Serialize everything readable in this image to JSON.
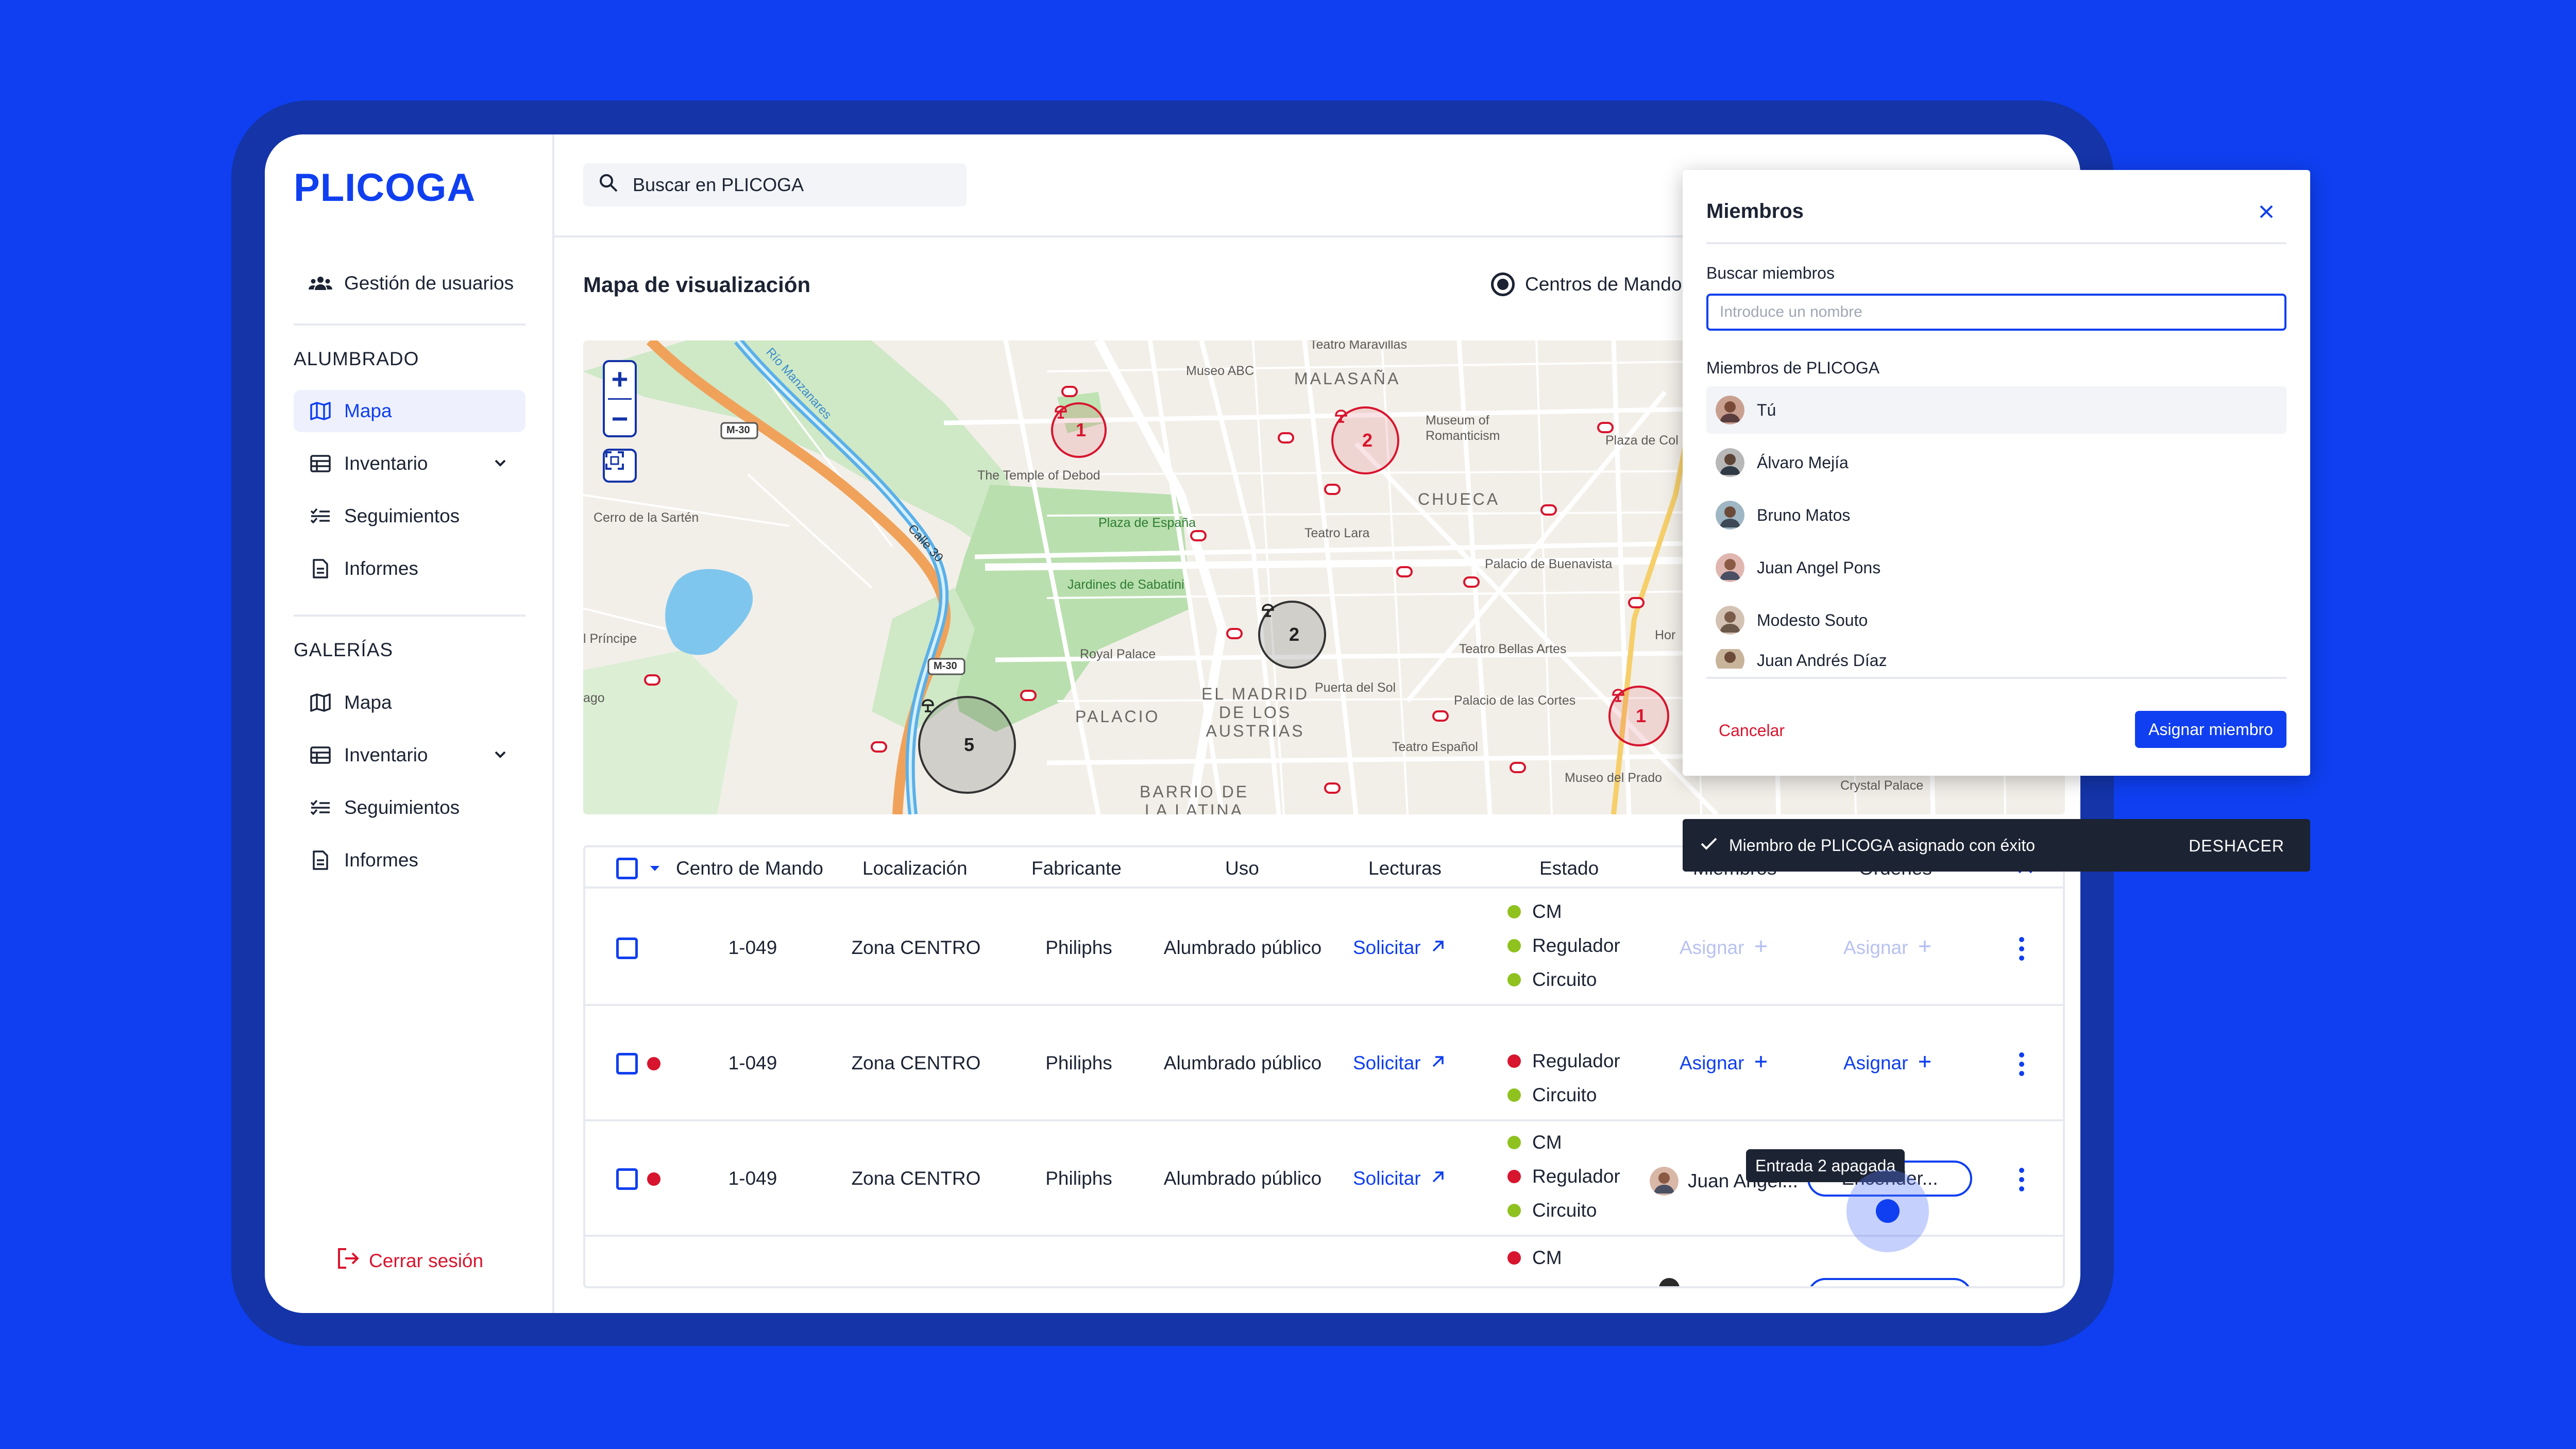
{
  "app": {
    "logo": "PLICOGA"
  },
  "sidebar": {
    "user_management": "Gestión de usuarios",
    "section_lighting": {
      "title": "ALUMBRADO",
      "items": [
        {
          "label": "Mapa",
          "icon": "map-icon",
          "active": true
        },
        {
          "label": "Inventario",
          "icon": "table-icon",
          "expandable": true
        },
        {
          "label": "Seguimientos",
          "icon": "checklist-icon"
        },
        {
          "label": "Informes",
          "icon": "document-icon"
        }
      ]
    },
    "section_galleries": {
      "title": "GALERÍAS",
      "items": [
        {
          "label": "Mapa",
          "icon": "map-icon"
        },
        {
          "label": "Inventario",
          "icon": "table-icon",
          "expandable": true
        },
        {
          "label": "Seguimientos",
          "icon": "checklist-icon"
        },
        {
          "label": "Informes",
          "icon": "document-icon"
        }
      ]
    },
    "logout": "Cerrar sesión"
  },
  "search": {
    "placeholder": "Buscar en PLICOGA"
  },
  "main": {
    "title": "Mapa de visualización",
    "radio_option": "Centros de Mando"
  },
  "map": {
    "labels": {
      "m30a": "M-30",
      "m30b": "M-30",
      "rio": "Río Manzanares",
      "calle30": "Calle 30",
      "temple": "The Temple of Debod",
      "plaza_espana": "Plaza de España",
      "sabatini": "Jardines de Sabatini",
      "royal_palace": "Royal Palace",
      "palacio": "PALACIO",
      "madrid_austrias": "EL MADRID\nDE LOS\nAUSTRIAS",
      "barrio_latina": "BARRIO DE\nLA LATINA",
      "cerro": "Cerro de la Sartén",
      "principe": "l Príncipe",
      "lago": "ago",
      "museo_abc": "Museo ABC",
      "malasana": "MALASAÑA",
      "museum_romanticism": "Museum of\nRomanticism",
      "chueca": "CHUECA",
      "teatro_lara": "Teatro Lara",
      "palacio_buenavista": "Palacio de Buenavista",
      "teatro_bellas_artes": "Teatro Bellas Artes",
      "palacio_cortes": "Palacio de las Cortes",
      "puerta_sol": "Puerta del Sol",
      "teatro_espanol": "Teatro Español",
      "museo_prado": "Museo del Prado",
      "teatro_maravillas": "Teatro Maravillas",
      "plaza_col": "Plaza de Col",
      "crystal_palace": "Crystal Palace",
      "hor": "Hor"
    },
    "clusters": [
      {
        "count": "1",
        "style": "red"
      },
      {
        "count": "2",
        "style": "red"
      },
      {
        "count": "2",
        "style": "dark"
      },
      {
        "count": "5",
        "style": "dark"
      },
      {
        "count": "1",
        "style": "red"
      }
    ]
  },
  "table": {
    "headers": [
      "Centro de Mando",
      "Localización",
      "Fabricante",
      "Uso",
      "Lecturas",
      "Estado",
      "Miembros",
      "Órdenes"
    ],
    "rows": [
      {
        "id": "1-049",
        "location": "Zona CENTRO",
        "maker": "Philiphs",
        "use": "Alumbrado público",
        "reading": "Solicitar",
        "status": [
          {
            "label": "CM",
            "color": "green"
          },
          {
            "label": "Regulador",
            "color": "green"
          },
          {
            "label": "Circuito",
            "color": "green"
          }
        ],
        "members": "Asignar",
        "orders": "Asignar",
        "alert": false
      },
      {
        "id": "1-049",
        "location": "Zona CENTRO",
        "maker": "Philiphs",
        "use": "Alumbrado público",
        "reading": "Solicitar",
        "status": [
          {
            "label": "Regulador",
            "color": "red"
          },
          {
            "label": "Circuito",
            "color": "green"
          }
        ],
        "members": "Asignar",
        "orders": "Asignar",
        "alert": true
      },
      {
        "id": "1-049",
        "location": "Zona CENTRO",
        "maker": "Philiphs",
        "use": "Alumbrado público",
        "reading": "Solicitar",
        "status": [
          {
            "label": "CM",
            "color": "green"
          },
          {
            "label": "Regulador",
            "color": "red"
          },
          {
            "label": "Circuito",
            "color": "green"
          }
        ],
        "members": "Juan Angel...",
        "orders": "Encender...",
        "alert": true
      },
      {
        "status": [
          {
            "label": "CM",
            "color": "red"
          }
        ]
      }
    ],
    "tooltip": "Entrada 2 apagada"
  },
  "members_panel": {
    "title": "Miembros",
    "search_label": "Buscar miembros",
    "search_placeholder": "Introduce un nombre",
    "list_label": "Miembros de PLICOGA",
    "members": [
      {
        "name": "Tú",
        "selected": true
      },
      {
        "name": "Álvaro Mejía"
      },
      {
        "name": "Bruno Matos"
      },
      {
        "name": "Juan Angel Pons"
      },
      {
        "name": "Modesto Souto"
      },
      {
        "name": "Juan Andrés Díaz"
      }
    ],
    "cancel": "Cancelar",
    "assign": "Asignar miembro"
  },
  "snackbar": {
    "message": "Miembro de PLICOGA asignado con éxito",
    "action": "DESHACER"
  },
  "colors": {
    "brand": "#0f3ff0",
    "background": "#0f3ff0",
    "device": "#1434a8",
    "danger": "#d8152e",
    "ok": "#8fc21f",
    "dark": "#1c2333"
  }
}
